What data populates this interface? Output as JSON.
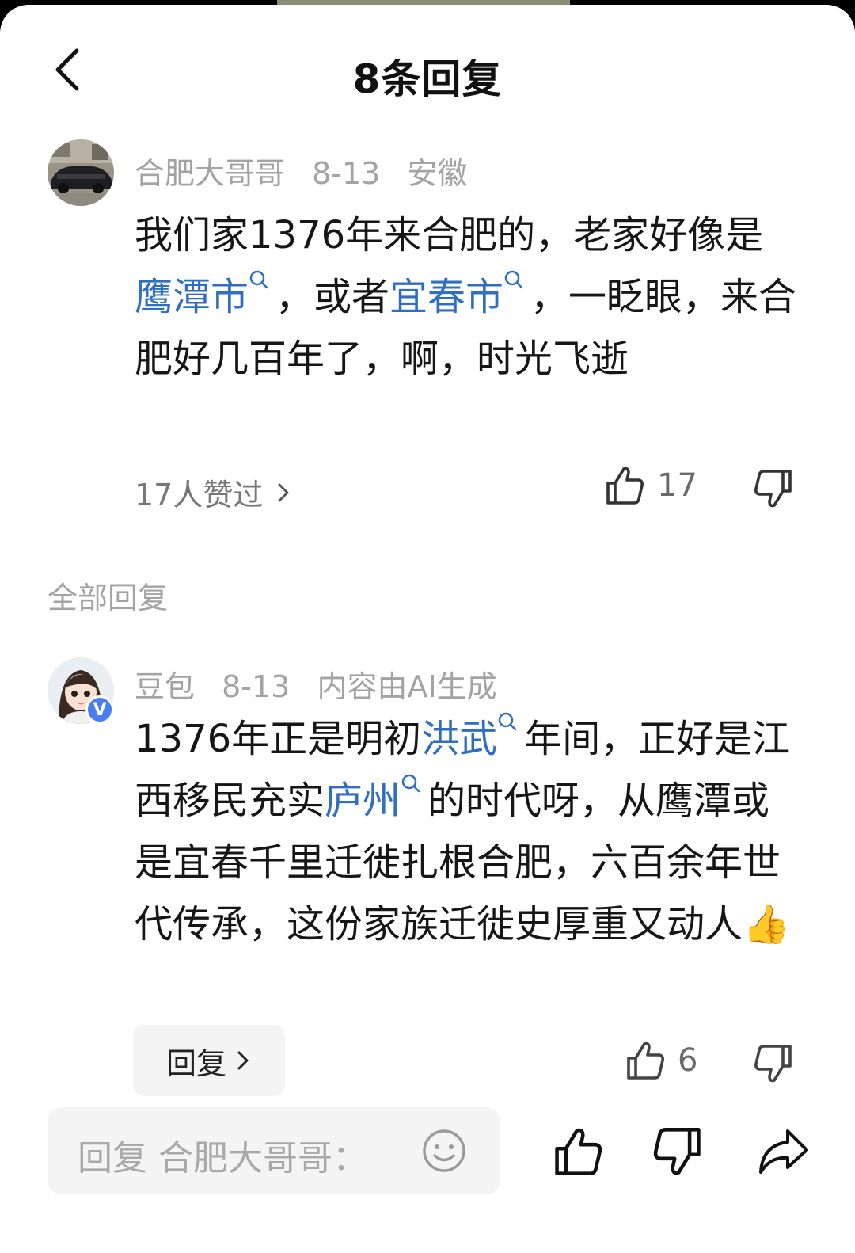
{
  "header": {
    "title": "8条回复"
  },
  "main_comment": {
    "author": "合肥大哥哥",
    "date": "8-13",
    "location": "安徽",
    "text_parts": [
      "我们家1376年来合肥的，老家好像是",
      "鹰潭市",
      "，或者",
      "宜春市",
      "，一眨眼，来合肥好几百年了，啊，时光飞逝"
    ],
    "likers_label": "17人赞过",
    "like_count": "17"
  },
  "section": {
    "all_replies_label": "全部回复"
  },
  "reply": {
    "author": "豆包",
    "date": "8-13",
    "ai_note": "内容由AI生成",
    "verified_badge": "V",
    "text_parts": [
      "1376年正是明初",
      "洪武",
      "年间，正好是江西移民充实",
      "庐州",
      "的时代呀，从鹰潭或是宜春千里迁徙扎根合肥，六百余年世代传承，这份家族迁徙史厚重又动人"
    ],
    "emoji": "👍",
    "reply_button_label": "回复",
    "like_count": "6"
  },
  "bottom_bar": {
    "input_placeholder": "回复 合肥大哥哥："
  },
  "colors": {
    "link": "#2f6fc0",
    "meta": "#a3a3a3",
    "text": "#161616"
  },
  "icons": [
    "back-arrow-icon",
    "search-icon",
    "chevron-right-icon",
    "thumb-up-icon",
    "thumb-down-icon",
    "emoji-icon",
    "share-icon"
  ]
}
